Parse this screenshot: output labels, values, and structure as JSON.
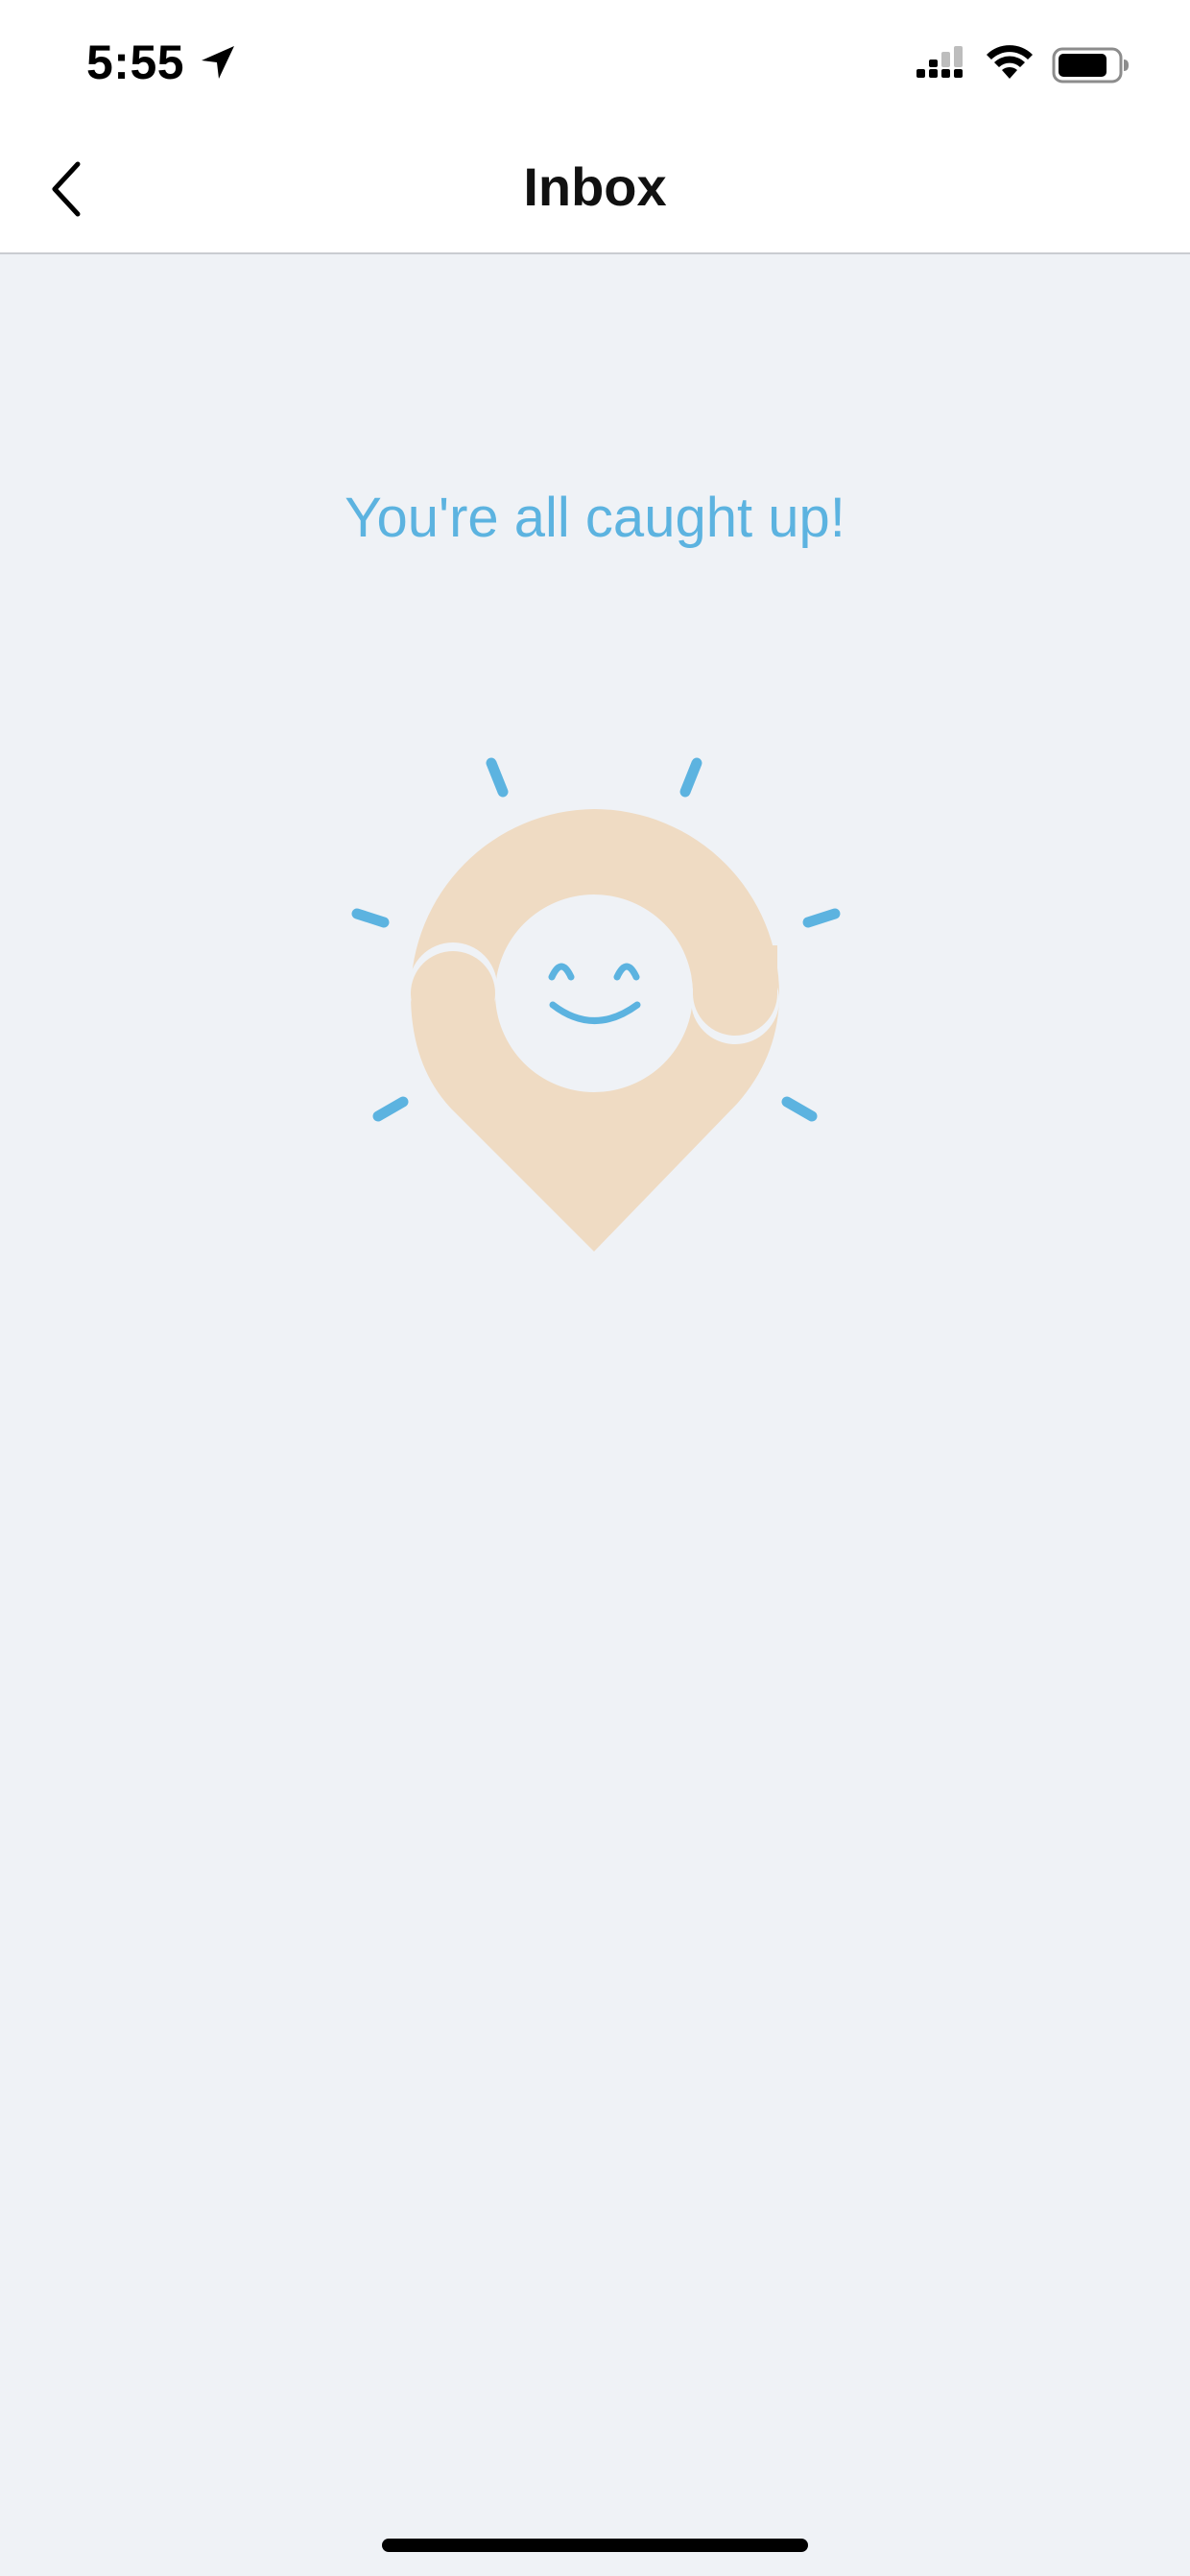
{
  "status_bar": {
    "time": "5:55",
    "icons": [
      "location-arrow-icon",
      "cellular-signal-icon",
      "wifi-icon",
      "battery-icon"
    ]
  },
  "nav": {
    "title": "Inbox",
    "back_icon": "chevron-left-icon"
  },
  "empty_state": {
    "message": "You're all caught up!",
    "illustration": "smiling-sun-location-pin"
  },
  "colors": {
    "background": "#eff2f6",
    "accent": "#5cb3e0",
    "pin": "#efdbc3",
    "header": "#ffffff"
  }
}
